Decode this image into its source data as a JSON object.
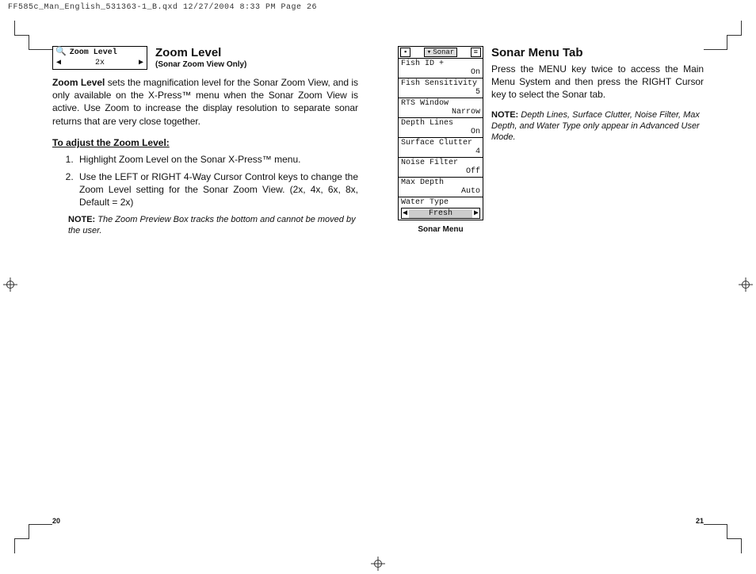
{
  "doc_header": "FF585c_Man_English_531363-1_B.qxd  12/27/2004  8:33 PM  Page 26",
  "left": {
    "widget": {
      "line1": "Zoom Level",
      "value": "2x"
    },
    "title": "Zoom Level",
    "subtitle": "(Sonar Zoom View Only)",
    "para": "Zoom Level sets the magnification level for the Sonar Zoom View, and is only available on the X-Press™ menu when the Sonar Zoom View is active. Use Zoom to increase the display resolution to separate sonar returns that are very close together.",
    "adjust_heading": "To adjust the Zoom Level:",
    "steps": [
      "Highlight Zoom Level on the Sonar X-Press™ menu.",
      "Use the LEFT or RIGHT 4-Way Cursor Control keys to change the Zoom Level setting for the Sonar Zoom View. (2x, 4x, 6x, 8x, Default = 2x)"
    ],
    "note_label": "NOTE:",
    "note": "The Zoom Preview Box tracks the bottom and cannot be moved by the user.",
    "page_num": "20"
  },
  "right": {
    "tab_label": "Sonar",
    "menu": [
      {
        "label": "Fish ID +",
        "value": "On"
      },
      {
        "label": "Fish Sensitivity",
        "value": "5"
      },
      {
        "label": "RTS Window",
        "value": "Narrow"
      },
      {
        "label": "Depth Lines",
        "value": "On"
      },
      {
        "label": "Surface Clutter",
        "value": "4"
      },
      {
        "label": "Noise Filter",
        "value": "Off"
      },
      {
        "label": "Max Depth",
        "value": "Auto"
      },
      {
        "label": "Water Type",
        "value": "Fresh",
        "selected": true
      }
    ],
    "caption": "Sonar Menu",
    "title": "Sonar Menu Tab",
    "para": "Press the MENU key twice to access the Main Menu System and then press the RIGHT Cursor key to select the Sonar tab.",
    "note_label": "NOTE:",
    "note": "Depth Lines, Surface Clutter, Noise Filter, Max Depth, and Water Type only appear in Advanced User Mode.",
    "page_num": "21"
  }
}
